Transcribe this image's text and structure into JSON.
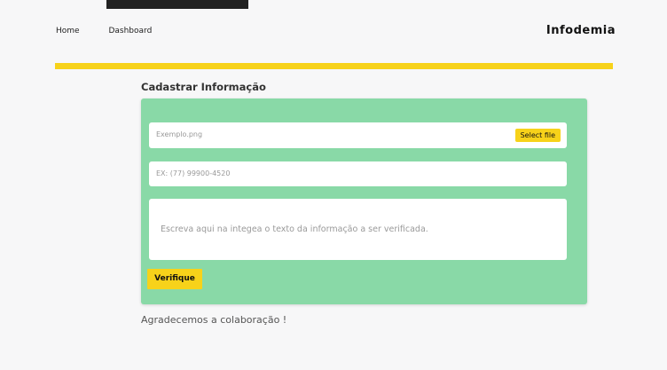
{
  "nav": {
    "items": [
      {
        "label": "Home"
      },
      {
        "label": "Dashboard"
      }
    ]
  },
  "brand": "Infodemia",
  "colors": {
    "accent": "#f7d21a",
    "card": "#89d9a7"
  },
  "form": {
    "title": "Cadastrar Informação",
    "file": {
      "placeholder": "Exemplo.png",
      "button": "Select file"
    },
    "phone": {
      "placeholder": "EX: (77) 99900-4520"
    },
    "text": {
      "placeholder": "Escreva aqui na integea o texto da informação a ser verificada."
    },
    "submit": "Verifique"
  },
  "footer_note": "Agradecemos a colaboração !"
}
